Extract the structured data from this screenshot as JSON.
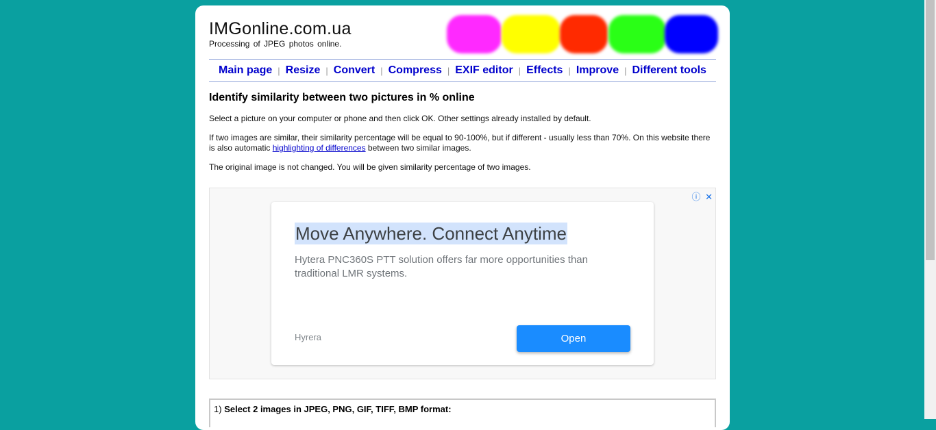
{
  "site": {
    "title": "IMGonline.com.ua",
    "subtitle": "Processing of JPEG photos online."
  },
  "nav": [
    {
      "label": "Main page"
    },
    {
      "label": "Resize"
    },
    {
      "label": "Convert"
    },
    {
      "label": "Compress"
    },
    {
      "label": "EXIF editor"
    },
    {
      "label": "Effects"
    },
    {
      "label": "Improve"
    },
    {
      "label": "Different tools"
    }
  ],
  "nav_separator": "|",
  "content": {
    "heading": "Identify similarity between two pictures in % online",
    "p1": "Select a picture on your computer or phone and then click OK. Other settings already installed by default.",
    "p2_before": "If two images are similar, their similarity percentage will be equal to 90-100%, but if different - usually less than 70%. On this website there is also automatic ",
    "p2_link": "highlighting of differences",
    "p2_after": " between two similar images.",
    "p3": "The original image is not changed. You will be given similarity percentage of two images."
  },
  "ad": {
    "headline": "Move Anywhere. Connect Anytime",
    "body": "Hytera PNC360S PTT solution offers far more opportunities than traditional LMR systems.",
    "brand": "Hyrera",
    "button": "Open",
    "info_icon": "ⓘ",
    "close_icon": "✕"
  },
  "step1": {
    "number": "1)",
    "label": "Select 2 images in JPEG, PNG, GIF, TIFF, BMP format:"
  },
  "colors": {
    "background": "#0aa0a0",
    "link": "#0000cc",
    "ad_button": "#1a8cff"
  }
}
